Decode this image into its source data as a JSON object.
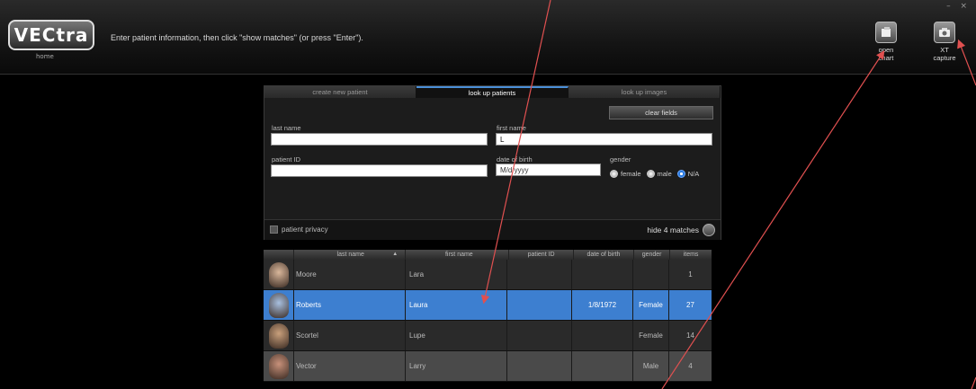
{
  "app": {
    "logo": "VECtra",
    "logo_sub": "home",
    "instruction": "Enter patient information, then click \"show matches\" (or press \"Enter\").",
    "window_controls": "– ×"
  },
  "toolbar": {
    "open_chart": "open\nchart",
    "xt_capture": "XT\ncapture"
  },
  "tabs": [
    {
      "label": "create new patient"
    },
    {
      "label": "look up patients",
      "active": true
    },
    {
      "label": "look up images"
    }
  ],
  "form": {
    "clear_fields": "clear fields",
    "last_name_label": "last name",
    "last_name_value": "",
    "first_name_label": "first name",
    "first_name_value": "L",
    "patient_id_label": "patient ID",
    "patient_id_value": "",
    "dob_label": "date of birth",
    "dob_placeholder": "M/d/yyyy",
    "gender_label": "gender",
    "gender_options": [
      "female",
      "male",
      "N/A"
    ],
    "gender_selected": "N/A",
    "patient_privacy": "patient privacy",
    "hide_matches": "hide 4 matches"
  },
  "table": {
    "columns": [
      "",
      "last name",
      "first name",
      "patient ID",
      "date of birth",
      "gender",
      "items"
    ],
    "sort_column": "last name",
    "rows": [
      {
        "last": "Moore",
        "first": "Lara",
        "pid": "",
        "dob": "",
        "gender": "",
        "items": "1",
        "face": "#d9b79b"
      },
      {
        "last": "Roberts",
        "first": "Laura",
        "pid": "",
        "dob": "1/8/1972",
        "gender": "Female",
        "items": "27",
        "face": "#a8c0e0",
        "selected": true
      },
      {
        "last": "Scortel",
        "first": "Lupe",
        "pid": "",
        "dob": "",
        "gender": "Female",
        "items": "14",
        "face": "#c9a07c"
      },
      {
        "last": "Vector",
        "first": "Larry",
        "pid": "",
        "dob": "",
        "gender": "Male",
        "items": "4",
        "face": "#c8917a"
      }
    ]
  },
  "colors": {
    "accent": "#3d7fd0",
    "arrow": "#e05050"
  }
}
